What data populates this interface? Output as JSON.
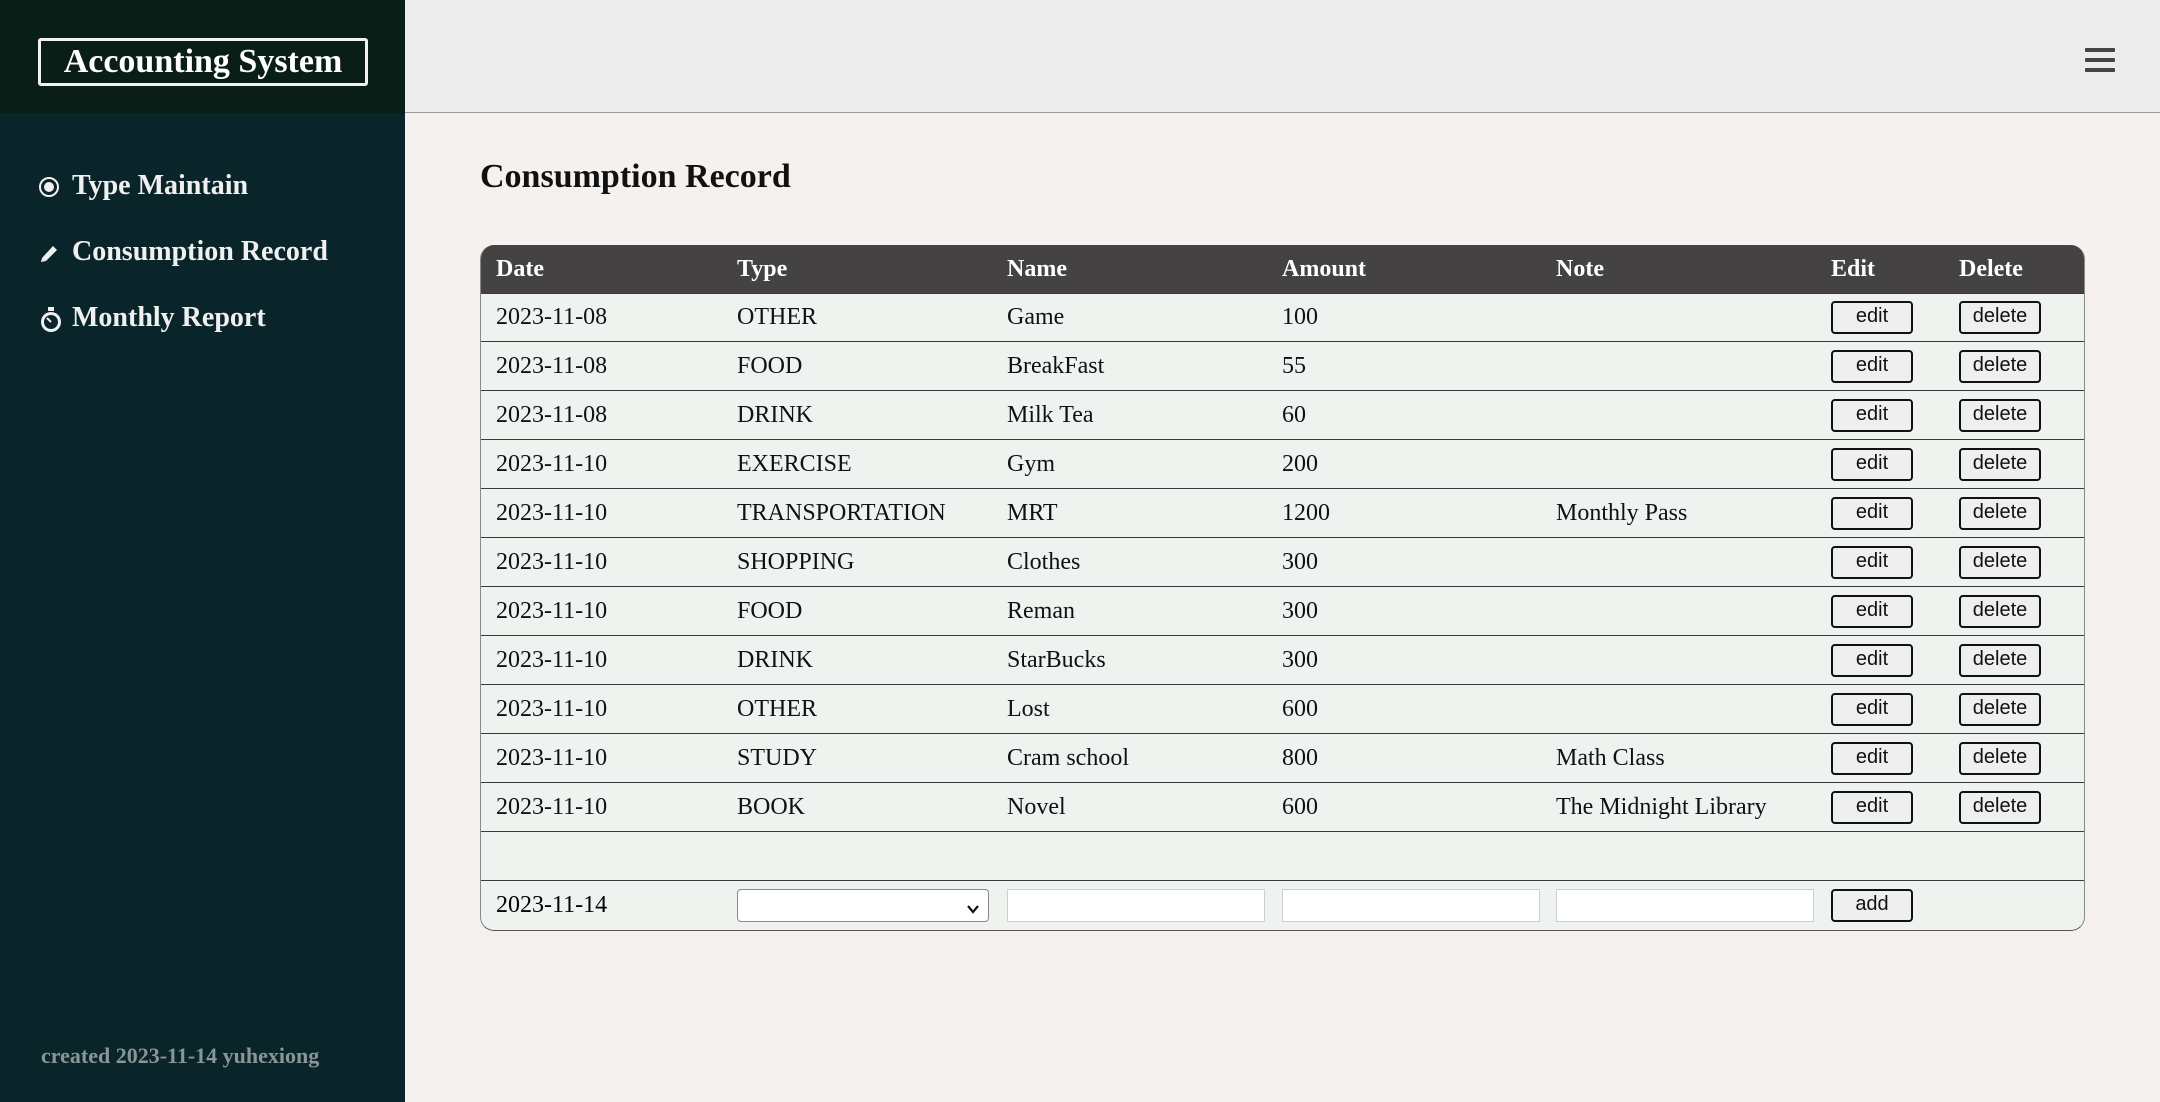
{
  "app": {
    "title": "Accounting System"
  },
  "sidebar": {
    "items": [
      {
        "label": "Type Maintain",
        "icon": "radio-icon"
      },
      {
        "label": "Consumption Record",
        "icon": "pencil-icon"
      },
      {
        "label": "Monthly Report",
        "icon": "stopwatch-icon"
      }
    ],
    "footer": "created 2023-11-14 yuhexiong"
  },
  "topbar": {
    "menu_icon": "hamburger-icon"
  },
  "main": {
    "title": "Consumption Record",
    "table": {
      "headers": [
        "Date",
        "Type",
        "Name",
        "Amount",
        "Note",
        "Edit",
        "Delete"
      ],
      "rows": [
        {
          "date": "2023-11-08",
          "type": "OTHER",
          "name": "Game",
          "amount": "100",
          "note": ""
        },
        {
          "date": "2023-11-08",
          "type": "FOOD",
          "name": "BreakFast",
          "amount": "55",
          "note": ""
        },
        {
          "date": "2023-11-08",
          "type": "DRINK",
          "name": "Milk Tea",
          "amount": "60",
          "note": ""
        },
        {
          "date": "2023-11-10",
          "type": "EXERCISE",
          "name": "Gym",
          "amount": "200",
          "note": ""
        },
        {
          "date": "2023-11-10",
          "type": "TRANSPORTATION",
          "name": "MRT",
          "amount": "1200",
          "note": "Monthly Pass"
        },
        {
          "date": "2023-11-10",
          "type": "SHOPPING",
          "name": "Clothes",
          "amount": "300",
          "note": ""
        },
        {
          "date": "2023-11-10",
          "type": "FOOD",
          "name": "Reman",
          "amount": "300",
          "note": ""
        },
        {
          "date": "2023-11-10",
          "type": "DRINK",
          "name": "StarBucks",
          "amount": "300",
          "note": ""
        },
        {
          "date": "2023-11-10",
          "type": "OTHER",
          "name": "Lost",
          "amount": "600",
          "note": ""
        },
        {
          "date": "2023-11-10",
          "type": "STUDY",
          "name": "Cram school",
          "amount": "800",
          "note": "Math Class"
        },
        {
          "date": "2023-11-10",
          "type": "BOOK",
          "name": "Novel",
          "amount": "600",
          "note": "The Midnight Library"
        }
      ],
      "edit_label": "edit",
      "delete_label": "delete",
      "new_row": {
        "date": "2023-11-14",
        "type_value": "",
        "name_value": "",
        "amount_value": "",
        "note_value": "",
        "add_label": "add"
      }
    }
  },
  "colors": {
    "sidebar": "#0a252a",
    "brand_bar": "#0a1e18",
    "header_row": "#444242",
    "row_bg": "#eef3ef",
    "page_bg": "#f5f1ee"
  }
}
